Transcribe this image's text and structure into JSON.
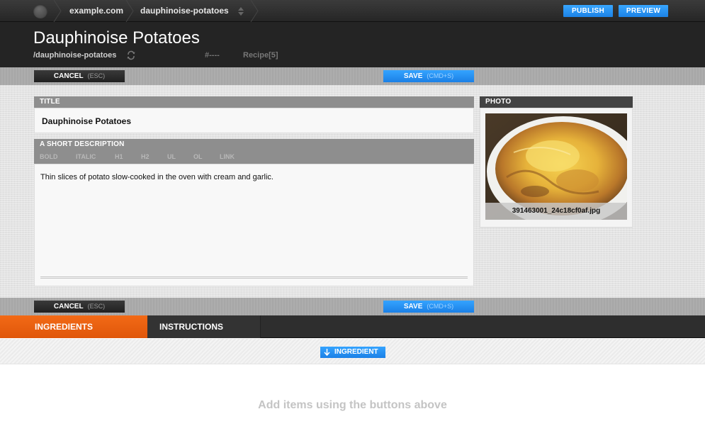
{
  "topbar": {
    "site": "example.com",
    "page": "dauphinoise-potatoes",
    "publish_label": "PUBLISH",
    "preview_label": "PREVIEW"
  },
  "header": {
    "title": "Dauphinoise Potatoes",
    "slug": "/dauphinoise-potatoes",
    "hash": "#----",
    "type": "Recipe[5]"
  },
  "actions": {
    "cancel_label": "CANCEL",
    "cancel_hint": "(ESC)",
    "save_label": "SAVE",
    "save_hint": "(CMD+S)"
  },
  "form": {
    "title_label": "TITLE",
    "title_value": "Dauphinoise Potatoes",
    "description_label": "A SHORT DESCRIPTION",
    "toolbar": [
      "BOLD",
      "ITALIC",
      "H1",
      "H2",
      "UL",
      "OL",
      "LINK"
    ],
    "description_value": "Thin slices of potato slow-cooked in the oven with cream and garlic.",
    "photo_label": "PHOTO",
    "photo_filename": "391463001_24c18cf0af.jpg"
  },
  "tabs": [
    {
      "label": "INGREDIENTS",
      "active": true
    },
    {
      "label": "INSTRUCTIONS",
      "active": false
    }
  ],
  "list": {
    "add_ingredient_label": "INGREDIENT",
    "empty_message": "Add items using the buttons above"
  },
  "colors": {
    "accent_blue": "#1c82e6",
    "accent_orange": "#e8600f",
    "dark_bar": "#242424"
  }
}
